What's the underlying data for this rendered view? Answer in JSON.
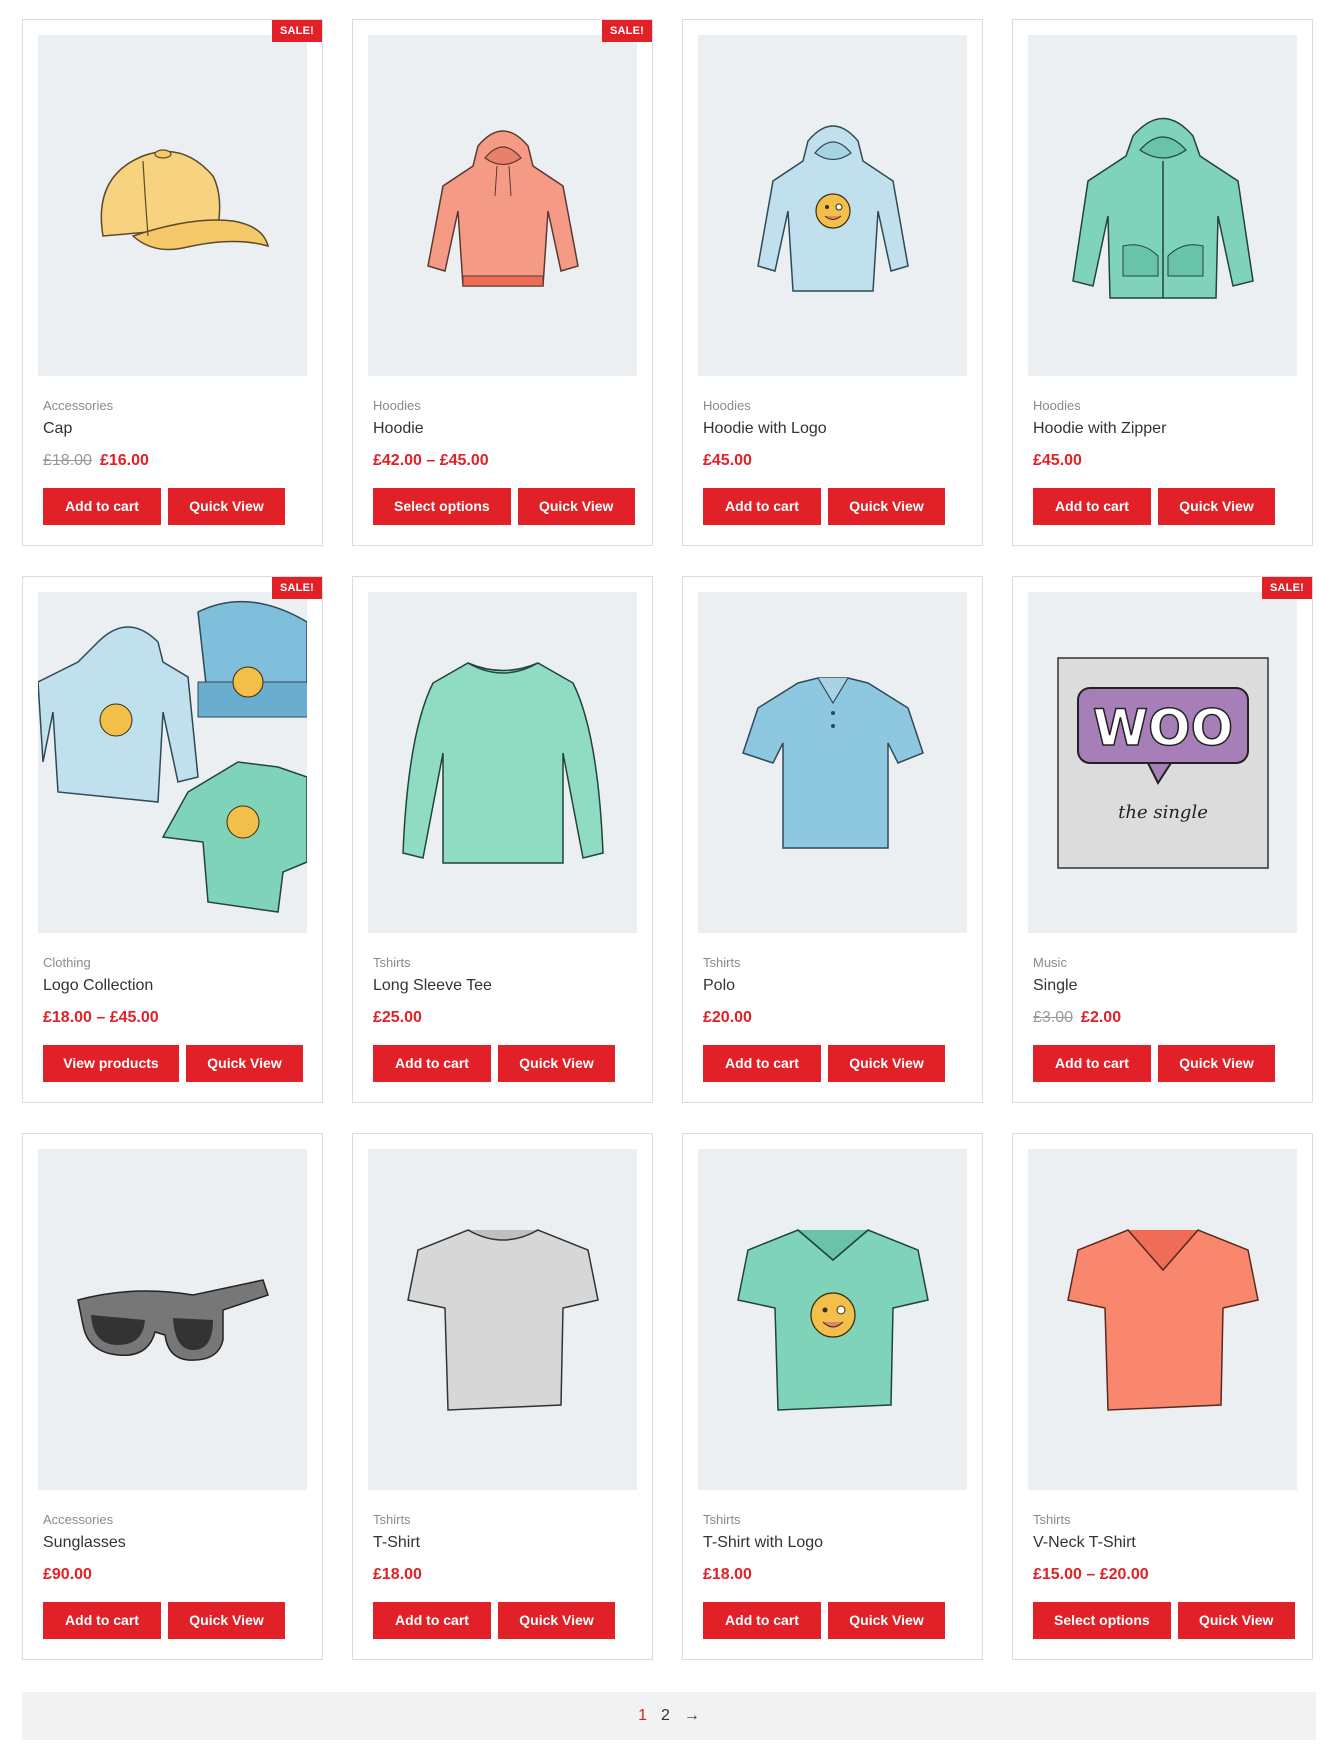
{
  "colors": {
    "accent": "#e12127",
    "thumb_bg": "#ebeff2",
    "pager_bg": "#f2f2f2"
  },
  "sale_label": "SALE!",
  "products": [
    {
      "category": "Accessories",
      "title": "Cap",
      "old_price": "£18.00",
      "price": "£16.00",
      "primary_button": "Add to cart",
      "secondary_button": "Quick View",
      "sale": true,
      "icon": "cap-icon"
    },
    {
      "category": "Hoodies",
      "title": "Hoodie",
      "old_price": "",
      "price": "£42.00 – £45.00",
      "primary_button": "Select options",
      "secondary_button": "Quick View",
      "sale": true,
      "icon": "hoodie-icon"
    },
    {
      "category": "Hoodies",
      "title": "Hoodie with Logo",
      "old_price": "",
      "price": "£45.00",
      "primary_button": "Add to cart",
      "secondary_button": "Quick View",
      "sale": false,
      "icon": "hoodie-logo-icon"
    },
    {
      "category": "Hoodies",
      "title": "Hoodie with Zipper",
      "old_price": "",
      "price": "£45.00",
      "primary_button": "Add to cart",
      "secondary_button": "Quick View",
      "sale": false,
      "icon": "zip-hoodie-icon"
    },
    {
      "category": "Clothing",
      "title": "Logo Collection",
      "old_price": "",
      "price": "£18.00 – £45.00",
      "primary_button": "View products",
      "secondary_button": "Quick View",
      "sale": true,
      "icon": "logo-collection-icon"
    },
    {
      "category": "Tshirts",
      "title": "Long Sleeve Tee",
      "old_price": "",
      "price": "£25.00",
      "primary_button": "Add to cart",
      "secondary_button": "Quick View",
      "sale": false,
      "icon": "long-sleeve-icon"
    },
    {
      "category": "Tshirts",
      "title": "Polo",
      "old_price": "",
      "price": "£20.00",
      "primary_button": "Add to cart",
      "secondary_button": "Quick View",
      "sale": false,
      "icon": "polo-icon"
    },
    {
      "category": "Music",
      "title": "Single",
      "old_price": "£3.00",
      "price": "£2.00",
      "primary_button": "Add to cart",
      "secondary_button": "Quick View",
      "sale": true,
      "icon": "woo-single-icon"
    },
    {
      "category": "Accessories",
      "title": "Sunglasses",
      "old_price": "",
      "price": "£90.00",
      "primary_button": "Add to cart",
      "secondary_button": "Quick View",
      "sale": false,
      "icon": "sunglasses-icon"
    },
    {
      "category": "Tshirts",
      "title": "T-Shirt",
      "old_price": "",
      "price": "£18.00",
      "primary_button": "Add to cart",
      "secondary_button": "Quick View",
      "sale": false,
      "icon": "tshirt-icon"
    },
    {
      "category": "Tshirts",
      "title": "T-Shirt with Logo",
      "old_price": "",
      "price": "£18.00",
      "primary_button": "Add to cart",
      "secondary_button": "Quick View",
      "sale": false,
      "icon": "tshirt-logo-icon"
    },
    {
      "category": "Tshirts",
      "title": "V-Neck T-Shirt",
      "old_price": "",
      "price": "£15.00 – £20.00",
      "primary_button": "Select options",
      "secondary_button": "Quick View",
      "sale": false,
      "icon": "vneck-icon"
    }
  ],
  "woo_text": "WOO",
  "woo_sub": "the single",
  "pagination": {
    "current": "1",
    "page2": "2",
    "next": "→"
  }
}
